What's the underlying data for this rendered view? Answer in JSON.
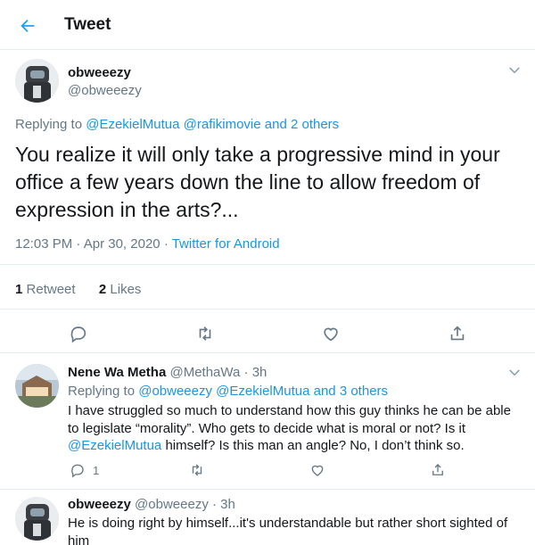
{
  "header": {
    "title": "Tweet"
  },
  "main_tweet": {
    "author_name": "obweeezy",
    "author_handle": "@obweeezy",
    "replying_prefix": "Replying to",
    "replying_users": [
      "@EzekielMutua",
      "@rafikimovie"
    ],
    "replying_others": "2 others",
    "replying_and": "and",
    "text": "You realize it will only take a progressive mind in your office a few years down the line to allow  freedom of expression in the arts?...",
    "time": "12:03 PM",
    "date": "Apr 30, 2020",
    "dot": "·",
    "source": "Twitter for Android",
    "retweet_count": "1",
    "retweet_label": "Retweet",
    "like_count": "2",
    "like_label": "Likes"
  },
  "replies": [
    {
      "author_name": "Nene Wa Metha",
      "author_handle": "@MethaWa",
      "dot": "·",
      "age": "3h",
      "replying_prefix": "Replying to",
      "replying_users": [
        "@obweeezy",
        "@EzekielMutua"
      ],
      "replying_and": "and",
      "replying_others": "3 others",
      "text_before": "I have struggled so much to understand how this guy thinks he can be able to legislate “morality”. Who gets to decide what is moral or not? Is it ",
      "text_mention": "@EzekielMutua",
      "text_after": " himself? Is this man an angle? No, I don’t think so.",
      "reply_count": "1"
    },
    {
      "author_name": "obweeezy",
      "author_handle": "@obweeezy",
      "dot": "·",
      "age": "3h",
      "text": "He is doing right by himself...it's understandable but rather short sighted of him"
    }
  ],
  "colors": {
    "accent": "#1b95e0",
    "muted": "#657786",
    "border": "#e6ecf0"
  }
}
